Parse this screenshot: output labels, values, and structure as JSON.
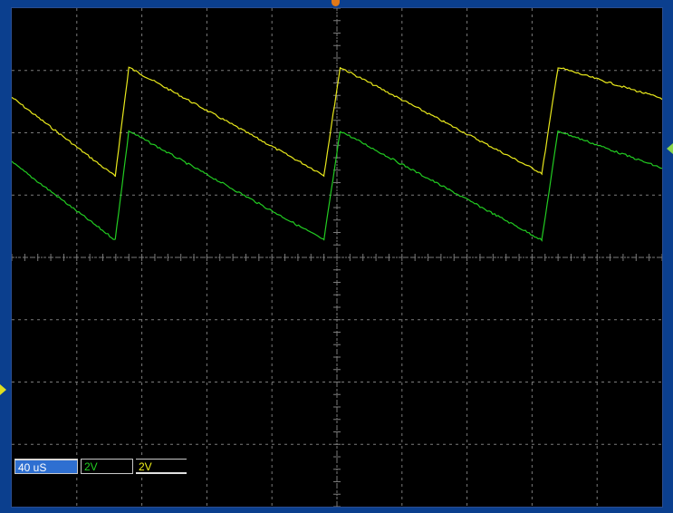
{
  "readouts": {
    "timebase": "40 uS",
    "ch2_volts_per_div": "2V",
    "ch1_volts_per_div": "2V"
  },
  "colors": {
    "background_frame": "#0b3f8e",
    "screen": "#000000",
    "grid": "#7a7a7a",
    "trace_ch1": "#e8e81c",
    "trace_ch2": "#22cc22",
    "timebase_box": "#2e6fd1",
    "trigger_marker": "#e07818"
  },
  "icons": {
    "trigger_marker": "trigger-position-icon",
    "ch1_level_marker": "channel-level-arrow-icon",
    "ch2_level_marker": "channel-level-arrow-icon"
  },
  "chart_data": {
    "type": "line",
    "title": "",
    "xlabel": "",
    "ylabel": "",
    "grid": true,
    "divisions": {
      "x": 10,
      "y": 8
    },
    "time_per_div_us": 40,
    "volts_per_div": [
      2,
      2
    ],
    "series": [
      {
        "channel": "yellow",
        "waveform": "sawtooth",
        "x_div": [
          0.0,
          1.59,
          1.8,
          4.8,
          5.05,
          8.15,
          8.4,
          10.0
        ],
        "y_div": [
          2.57,
          1.3,
          3.05,
          1.32,
          3.05,
          1.35,
          3.05,
          2.55
        ]
      },
      {
        "channel": "green",
        "waveform": "sawtooth",
        "x_div": [
          0.0,
          1.59,
          1.8,
          4.8,
          5.05,
          8.15,
          8.4,
          10.0
        ],
        "y_div": [
          1.53,
          0.28,
          2.03,
          0.28,
          2.03,
          0.28,
          2.03,
          1.43
        ]
      }
    ]
  }
}
